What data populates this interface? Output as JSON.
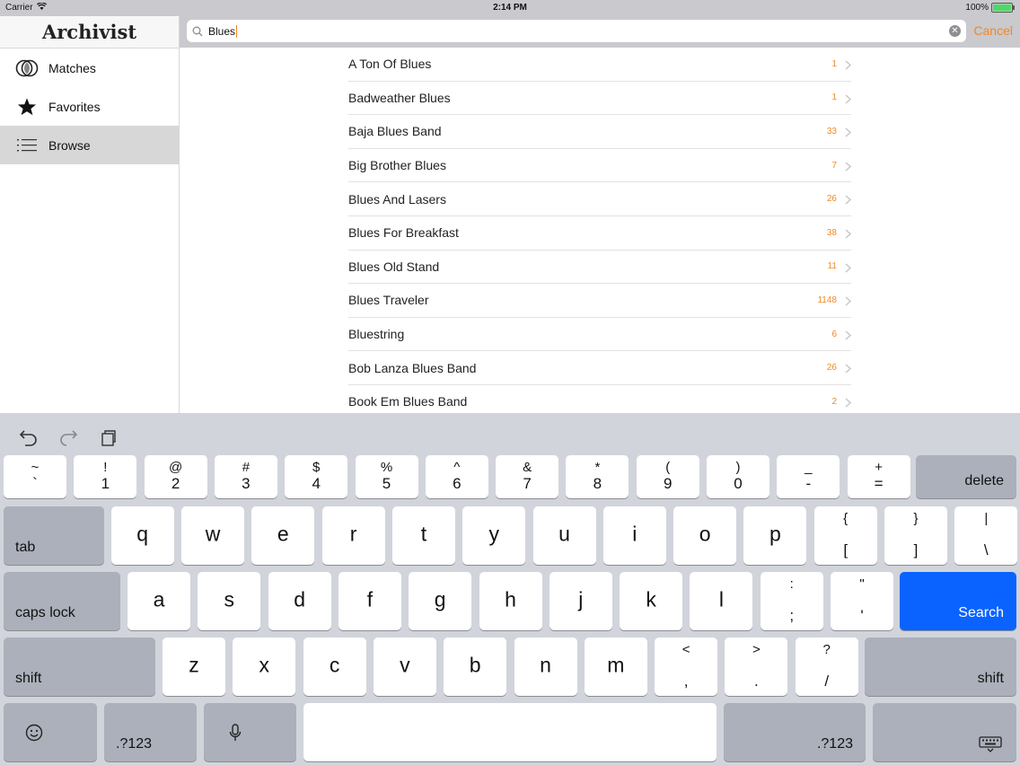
{
  "status": {
    "carrier": "Carrier",
    "time": "2:14 PM",
    "battery": "100%"
  },
  "app": {
    "title": "Archivist"
  },
  "sidebar": {
    "items": [
      {
        "label": "Matches",
        "icon": "matches-circles-icon"
      },
      {
        "label": "Favorites",
        "icon": "star-icon"
      },
      {
        "label": "Browse",
        "icon": "list-icon",
        "selected": true
      }
    ]
  },
  "search": {
    "value": "Blues",
    "cancel_label": "Cancel"
  },
  "results": [
    {
      "name": "A Ton Of Blues",
      "count": "1"
    },
    {
      "name": "Badweather Blues",
      "count": "1"
    },
    {
      "name": "Baja Blues Band",
      "count": "33"
    },
    {
      "name": "Big Brother Blues",
      "count": "7"
    },
    {
      "name": "Blues And Lasers",
      "count": "26"
    },
    {
      "name": "Blues For Breakfast",
      "count": "38"
    },
    {
      "name": "Blues Old Stand",
      "count": "11"
    },
    {
      "name": "Blues Traveler",
      "count": "1148"
    },
    {
      "name": "Bluestring",
      "count": "6"
    },
    {
      "name": "Bob Lanza Blues Band",
      "count": "26"
    },
    {
      "name": "Book Em Blues Band",
      "count": "2"
    }
  ],
  "keyboard": {
    "number_row": [
      {
        "top": "~",
        "bottom": "`"
      },
      {
        "top": "!",
        "bottom": "1"
      },
      {
        "top": "@",
        "bottom": "2"
      },
      {
        "top": "#",
        "bottom": "3"
      },
      {
        "top": "$",
        "bottom": "4"
      },
      {
        "top": "%",
        "bottom": "5"
      },
      {
        "top": "^",
        "bottom": "6"
      },
      {
        "top": "&",
        "bottom": "7"
      },
      {
        "top": "*",
        "bottom": "8"
      },
      {
        "top": "(",
        "bottom": "9"
      },
      {
        "top": ")",
        "bottom": "0"
      },
      {
        "top": "_",
        "bottom": "-"
      },
      {
        "top": "+",
        "bottom": "="
      }
    ],
    "row_q": [
      "q",
      "w",
      "e",
      "r",
      "t",
      "y",
      "u",
      "i",
      "o",
      "p"
    ],
    "row_q_extra": [
      {
        "top": "{",
        "bottom": "["
      },
      {
        "top": "}",
        "bottom": "]"
      },
      {
        "top": "|",
        "bottom": "\\"
      }
    ],
    "row_a": [
      "a",
      "s",
      "d",
      "f",
      "g",
      "h",
      "j",
      "k",
      "l"
    ],
    "row_a_extra": [
      {
        "top": ":",
        "bottom": ";"
      },
      {
        "top": "\"",
        "bottom": "'"
      }
    ],
    "row_z": [
      "z",
      "x",
      "c",
      "v",
      "b",
      "n",
      "m"
    ],
    "row_z_extra": [
      {
        "top": "<",
        "bottom": ","
      },
      {
        "top": ">",
        "bottom": "."
      },
      {
        "top": "?",
        "bottom": "/"
      }
    ],
    "labels": {
      "delete": "delete",
      "tab": "tab",
      "caps_lock": "caps lock",
      "search": "Search",
      "shift": "shift",
      "numbers": ".?123"
    },
    "accent_color": "#0a63ff"
  },
  "colors": {
    "accent": "#f08a24",
    "selected_row": "#d7d7d7"
  }
}
